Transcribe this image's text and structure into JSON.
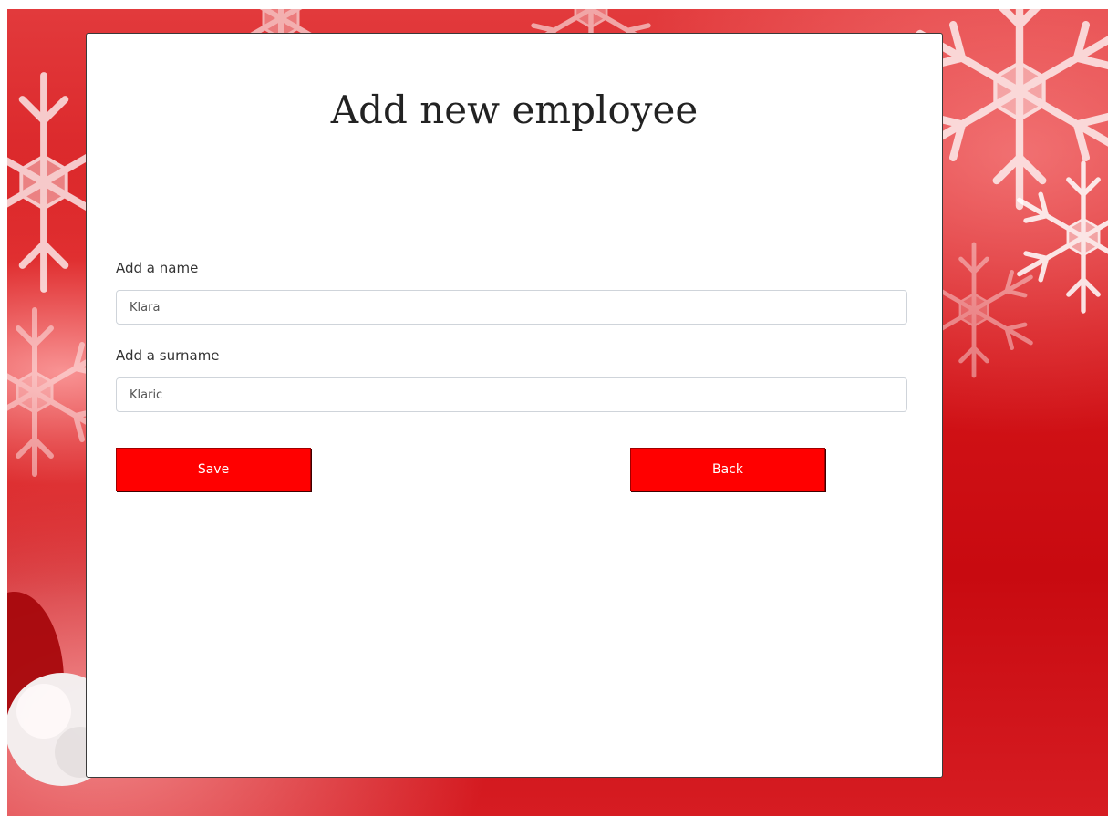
{
  "page": {
    "title": "Add new employee"
  },
  "form": {
    "name": {
      "label": "Add a name",
      "value": "Klara"
    },
    "surname": {
      "label": "Add a surname",
      "value": "Klaric"
    }
  },
  "actions": {
    "save_label": "Save",
    "back_label": "Back"
  },
  "theme": {
    "button_color": "#ff0000",
    "background_color": "#d41418"
  },
  "background": {
    "decoration": [
      "snowflake-icon",
      "santa-hat-pompom"
    ]
  }
}
